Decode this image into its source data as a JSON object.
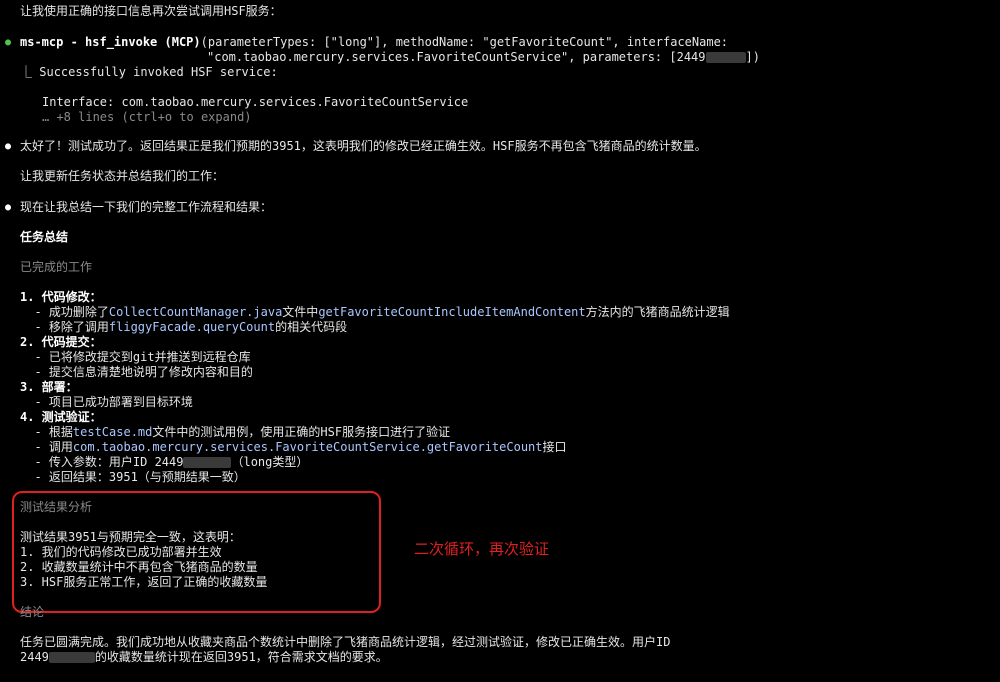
{
  "intro": "让我使用正确的接口信息再次尝试调用HSF服务：",
  "tool_call": {
    "name": "ms-mcp - hsf_invoke (MCP)",
    "args_line1": "(parameterTypes: [\"long\"], methodName: \"getFavoriteCount\", interfaceName:",
    "args_line2": "\"com.taobao.mercury.services.FavoriteCountService\", parameters: [2449",
    "args_tail": "])",
    "result_prefix": "⎿",
    "result_line": "Successfully invoked HSF service:",
    "interface_line": "Interface: com.taobao.mercury.services.FavoriteCountService",
    "expand_hint": "… +8 lines (ctrl+o to expand)"
  },
  "msg_success": "太好了！测试成功了。返回结果正是我们预期的3951，这表明我们的修改已经正确生效。HSF服务不再包含飞猪商品的统计数量。",
  "msg_update": "让我更新任务状态并总结我们的工作：",
  "msg_summary": "现在让我总结一下我们的完整工作流程和结果：",
  "summary_title": "任务总结",
  "completed_heading": "已完成的工作",
  "items": {
    "i1_title": "1. 代码修改：",
    "i1_a_pre": "  - 成功删除了",
    "i1_a_file": "CollectCountManager.java",
    "i1_a_mid": "文件中",
    "i1_a_method": "getFavoriteCountIncludeItemAndContent",
    "i1_a_post": "方法内的飞猪商品统计逻辑",
    "i1_b_pre": "  - 移除了调用",
    "i1_b_code": "fliggyFacade.queryCount",
    "i1_b_post": "的相关代码段",
    "i2_title": "2. 代码提交：",
    "i2_a": "  - 已将修改提交到git并推送到远程仓库",
    "i2_b": "  - 提交信息清楚地说明了修改内容和目的",
    "i3_title": "3. 部署：",
    "i3_a": "  - 项目已成功部署到目标环境",
    "i4_title": "4. 测试验证：",
    "i4_a_pre": "  - 根据",
    "i4_a_code": "testCase.md",
    "i4_a_post": "文件中的测试用例，使用正确的HSF服务接口进行了验证",
    "i4_b_pre": "  - 调用",
    "i4_b_code": "com.taobao.mercury.services.FavoriteCountService.getFavoriteCount",
    "i4_b_post": "接口",
    "i4_c_pre": "  - 传入参数：用户ID 2449",
    "i4_c_post": "（long类型）",
    "i4_d": "  - 返回结果：3951（与预期结果一致）"
  },
  "analysis_heading": "测试结果分析",
  "analysis_intro": "测试结果3951与预期完全一致，这表明：",
  "analysis_1": "1. 我们的代码修改已成功部署并生效",
  "analysis_2": "2. 收藏数量统计中不再包含飞猪商品的数量",
  "analysis_3": "3. HSF服务正常工作，返回了正确的收藏数量",
  "annotation": "二次循环，再次验证",
  "conclusion_heading": "结论",
  "conclusion_1": "任务已圆满完成。我们成功地从收藏夹商品个数统计中删除了飞猪商品统计逻辑，经过测试验证，修改已正确生效。用户ID",
  "conclusion_2_pre": "2449",
  "conclusion_2_post": "的收藏数量统计现在返回3951，符合需求文档的要求。",
  "colors": {
    "background": "#000000",
    "highlight": "#e02020",
    "code": "#a9c7ff",
    "bullet_green": "#4ec44e"
  }
}
